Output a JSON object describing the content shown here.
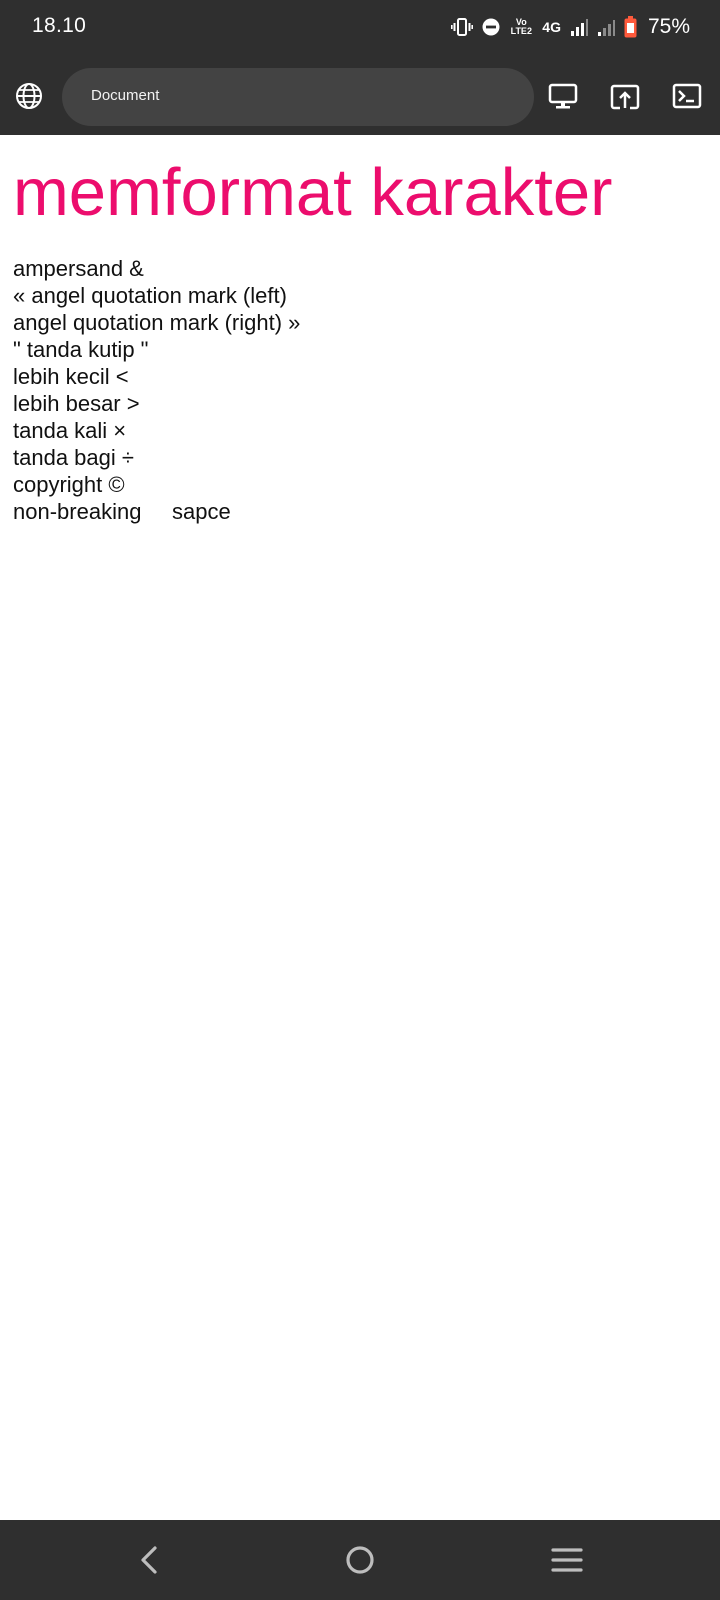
{
  "status_bar": {
    "time": "18.10",
    "network": "4G",
    "volte": "Vo LTE2",
    "battery_percent": "75%",
    "icons": [
      "vibrate-icon",
      "do-not-disturb-icon",
      "volte-icon",
      "signal-icon",
      "signal-icon-sim2",
      "battery-icon"
    ],
    "battery_color": "#ff5a3c"
  },
  "browser": {
    "url_text": "Document",
    "icons": [
      "globe-icon",
      "desktop-mode-icon",
      "share-upload-icon",
      "console-icon"
    ]
  },
  "page": {
    "title": "memformat karakter",
    "title_color": "#ec0d6d",
    "lines": [
      "ampersand &",
      "« angel quotation mark (left)",
      "angel quotation mark (right) »",
      "\" tanda kutip \"",
      "lebih kecil <",
      "lebih besar >",
      "tanda kali ×",
      "tanda bagi ÷",
      "copyright ©",
      "non-breaking     sapce"
    ]
  },
  "nav_bar": {
    "icons": [
      "back-icon",
      "home-icon",
      "recents-menu-icon"
    ]
  }
}
